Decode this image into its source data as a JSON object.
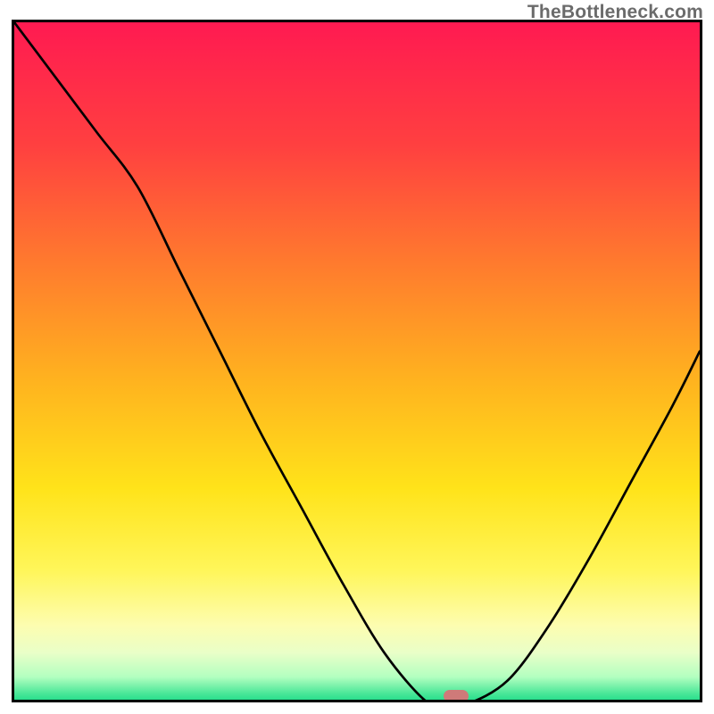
{
  "watermark": "TheBottleneck.com",
  "chart_data": {
    "type": "line",
    "title": "",
    "xlabel": "",
    "ylabel": "",
    "xlim": [
      0,
      100
    ],
    "ylim": [
      0,
      100
    ],
    "grid": false,
    "legend": false,
    "series": [
      {
        "name": "bottleneck-curve",
        "x": [
          0,
          6,
          12,
          18,
          24,
          30,
          36,
          42,
          48,
          54,
          60,
          63,
          66,
          72,
          78,
          84,
          90,
          96,
          100
        ],
        "y": [
          100,
          92,
          84,
          76,
          64,
          52,
          40,
          29,
          18,
          8,
          1,
          0.5,
          0.5,
          4,
          12,
          22,
          33,
          44,
          52
        ]
      }
    ],
    "marker": {
      "x": 64.5,
      "y": 0.5,
      "color": "#cf7a79"
    },
    "gradient_stops": [
      {
        "t": 0.0,
        "color": "#ff1a51"
      },
      {
        "t": 0.18,
        "color": "#ff4040"
      },
      {
        "t": 0.35,
        "color": "#ff7a2e"
      },
      {
        "t": 0.52,
        "color": "#ffb21f"
      },
      {
        "t": 0.68,
        "color": "#ffe31a"
      },
      {
        "t": 0.8,
        "color": "#fff65a"
      },
      {
        "t": 0.88,
        "color": "#fdfdb0"
      },
      {
        "t": 0.92,
        "color": "#e9ffc8"
      },
      {
        "t": 0.955,
        "color": "#b3ffc0"
      },
      {
        "t": 0.978,
        "color": "#4fe89a"
      },
      {
        "t": 1.0,
        "color": "#00d47e"
      }
    ]
  }
}
